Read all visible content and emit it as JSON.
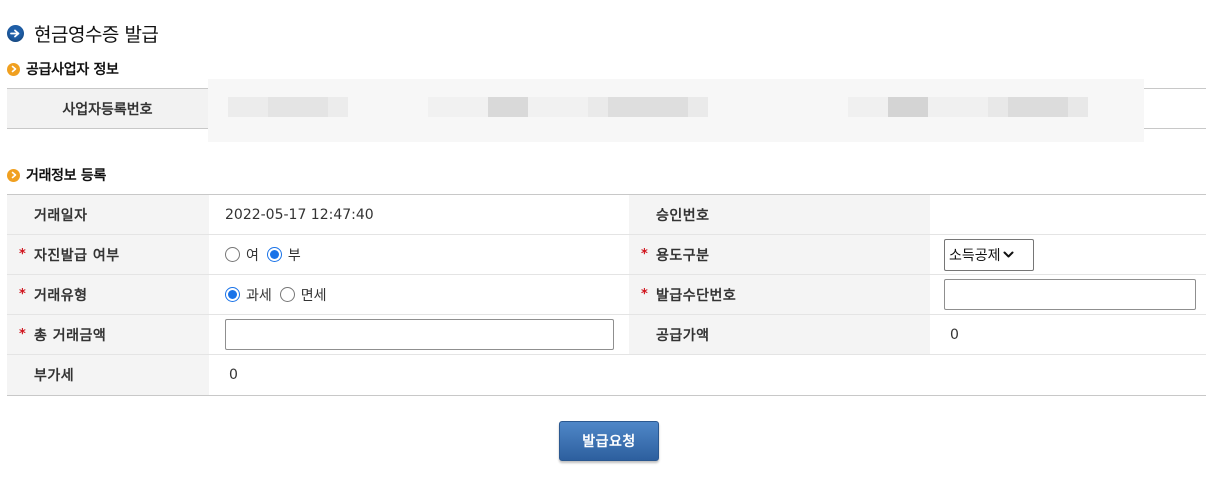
{
  "page": {
    "title": "현금영수증 발급"
  },
  "supplier_section": {
    "title": "공급사업자 정보",
    "reg_number_label": "사업자등록번호"
  },
  "trade_section": {
    "title": "거래정보 등록",
    "rows": {
      "trade_date": {
        "label": "거래일자",
        "value": "2022-05-17 12:47:40"
      },
      "approval_number": {
        "label": "승인번호",
        "value": ""
      },
      "self_issue": {
        "label": "자진발급 여부",
        "options": [
          "여",
          "부"
        ],
        "selected": "부"
      },
      "usage_type": {
        "label": "용도구분",
        "selected": "소득공제"
      },
      "trade_type": {
        "label": "거래유형",
        "options": [
          "과세",
          "면세"
        ],
        "selected": "과세"
      },
      "issue_means_number": {
        "label": "발급수단번호",
        "value": ""
      },
      "total_amount": {
        "label": "총 거래금액",
        "value": ""
      },
      "supply_amount": {
        "label": "공급가액",
        "value": "0"
      },
      "vat": {
        "label": "부가세",
        "value": "0"
      }
    },
    "required_mark": "*"
  },
  "submit": {
    "label": "발급요청"
  },
  "colors": {
    "accent": "#1f5fa8",
    "section_icon": "#f0a020",
    "required": "#d0121b",
    "button": "#2d5f9e"
  }
}
